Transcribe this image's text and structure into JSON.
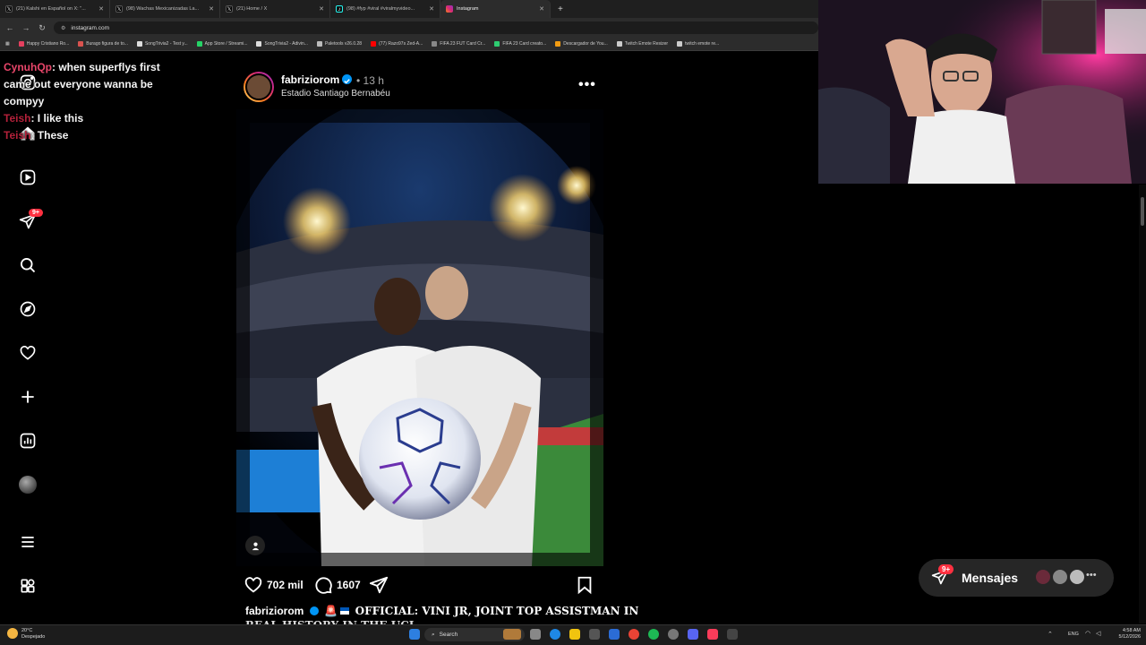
{
  "browser": {
    "tabs": [
      {
        "label": "(21) Kalshi en Español on X: \"...",
        "favicon": "x-icon",
        "active": false
      },
      {
        "label": "(98) Wachas Mexicanizadas La...",
        "favicon": "x-icon",
        "active": false
      },
      {
        "label": "(21) Home / X",
        "favicon": "x-icon",
        "active": false
      },
      {
        "label": "(98) #fyp #viral #viralmyvideo...",
        "favicon": "tiktok-icon",
        "active": false
      },
      {
        "label": "Instagram",
        "favicon": "instagram-icon",
        "active": true
      }
    ],
    "url": "instagram.com",
    "bookmarks": [
      {
        "label": "Happy Cristiano Ro...",
        "color": "#e4405f"
      },
      {
        "label": "Burago figura de to...",
        "color": "#d9534f"
      },
      {
        "label": "SongTrivia2 - Test y...",
        "color": "#ddd"
      },
      {
        "label": "App Store / Streami...",
        "color": "#25d366"
      },
      {
        "label": "SongTrivia2 - Adivin...",
        "color": "#ddd"
      },
      {
        "label": "Paletools v26.0.28",
        "color": "#bbb"
      },
      {
        "label": "(77) Razo97s Zed-A...",
        "color": "#ff0000"
      },
      {
        "label": "FIFA 23 FUT Card Cr...",
        "color": "#888"
      },
      {
        "label": "FIFA 23 Card creato...",
        "color": "#2ecc71"
      },
      {
        "label": "Descargador de You...",
        "color": "#f39c12"
      },
      {
        "label": "Twitch Emote Resizer",
        "color": "#ccc"
      },
      {
        "label": "twitch emote re...",
        "color": "#ccc"
      }
    ]
  },
  "chat": {
    "messages": [
      {
        "user": "CynuhQp",
        "text": ": when superflys first came out everyone wanna be compyy"
      },
      {
        "user": "Teish",
        "text": ": I like this"
      },
      {
        "user": "Teish",
        "text": ": These"
      }
    ]
  },
  "nav": {
    "notification_badge": "9+"
  },
  "post": {
    "username": "fabriziorom",
    "time": "• 13 h",
    "location": "Estadio Santiago Bernabéu",
    "likes": "702 mil",
    "comments": "1607",
    "caption_user": "fabriziorom",
    "caption_text": "OFFICIAL: VINI JR, JOINT TOP ASSISTMAN IN",
    "caption_line2": "REAL HISTORY IN THE UCL"
  },
  "messages_bar": {
    "label": "Mensajes",
    "badge": "9+"
  },
  "taskbar": {
    "weather_temp": "20°C",
    "weather_desc": "Despejado",
    "search_label": "Search",
    "language": "ENG",
    "time": "4:58 AM",
    "date": "5/12/2026"
  },
  "colors": {
    "accent_blue": "#0095f6",
    "badge_red": "#ff3040",
    "chat_user": "#e8466a"
  }
}
